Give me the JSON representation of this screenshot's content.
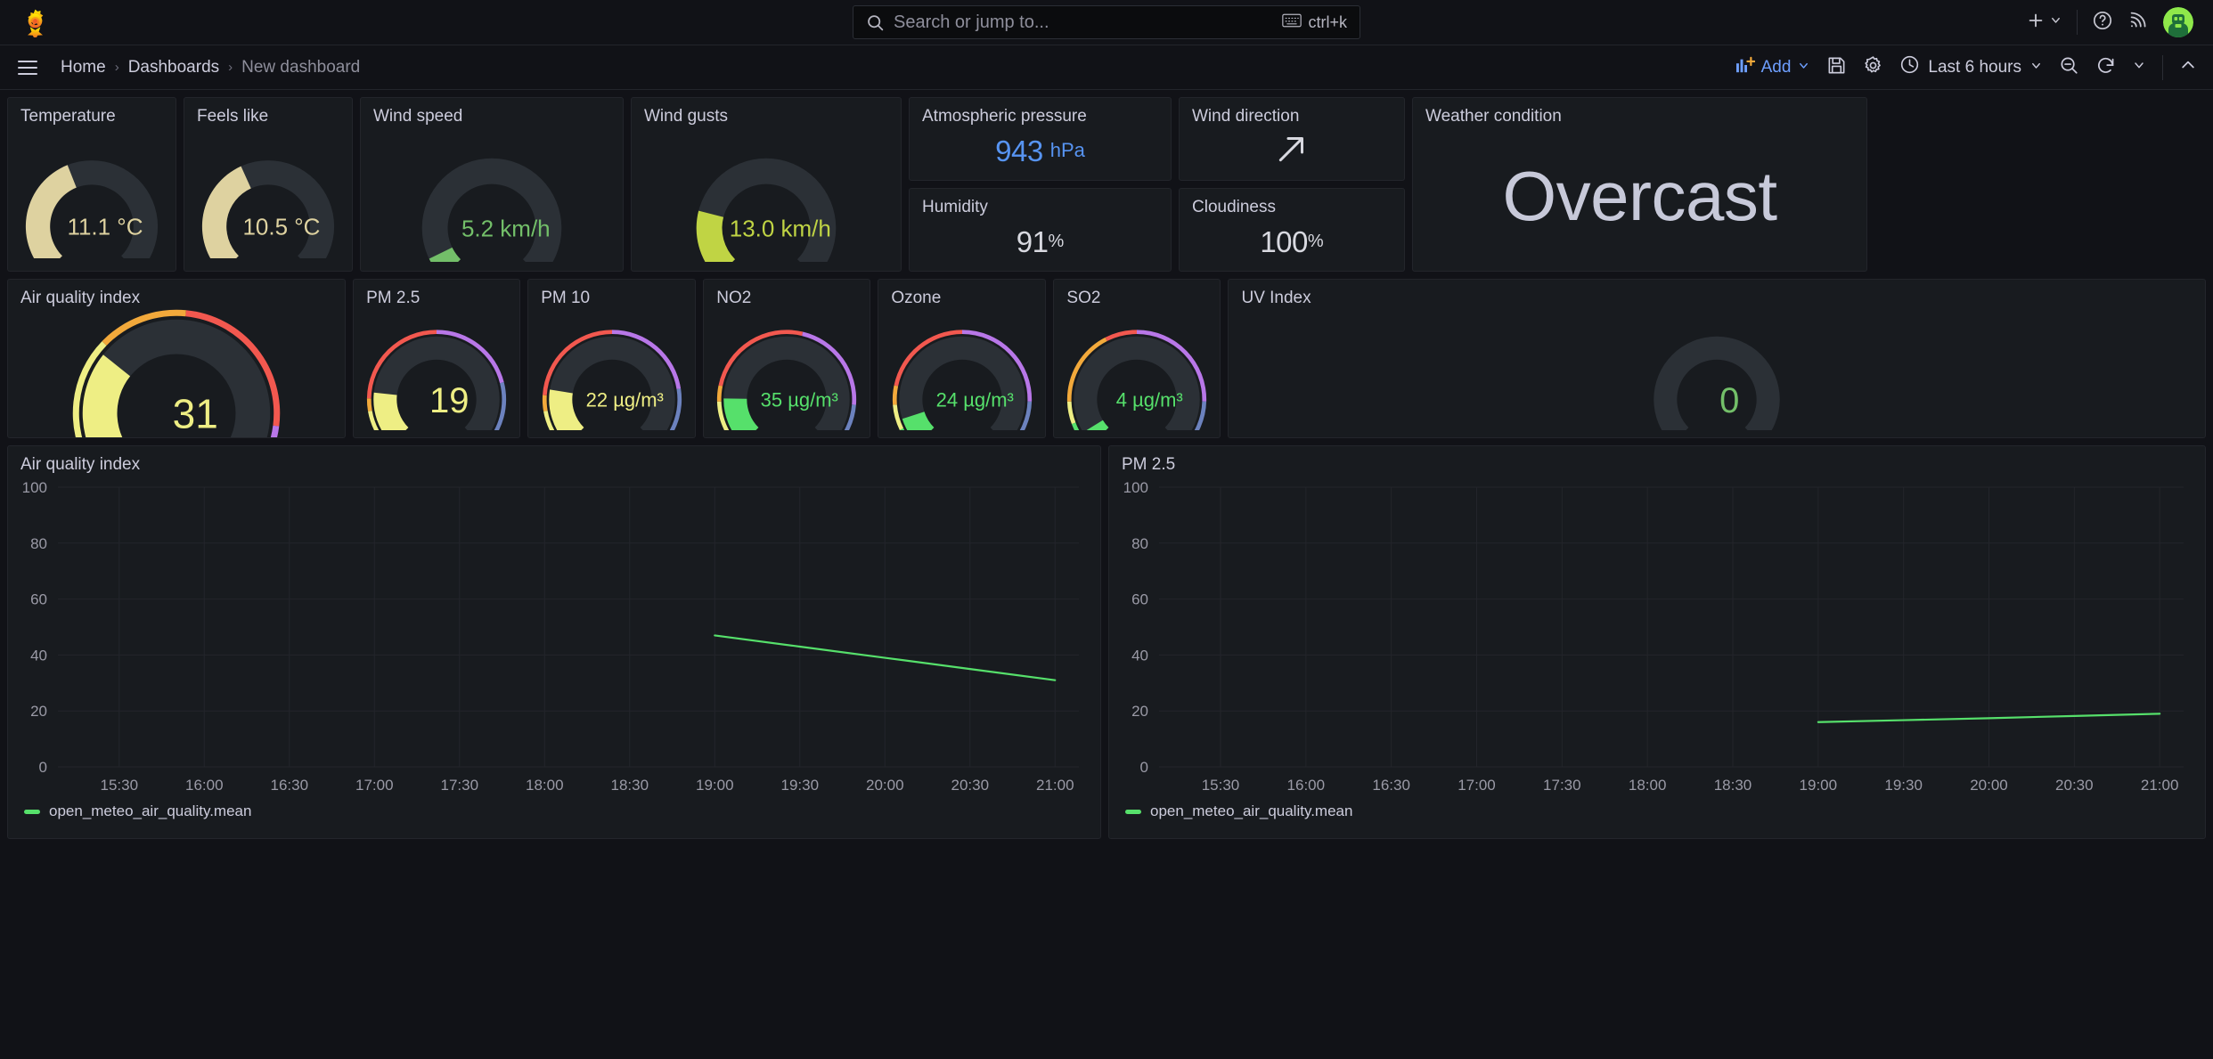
{
  "topnav": {
    "brand_icon": "grafana-logo-icon",
    "search": {
      "icon": "search-icon",
      "placeholder": "Search or jump to...",
      "value": "",
      "shortcut_icon": "keyboard-icon",
      "shortcut": "ctrl+k"
    },
    "actions": [
      {
        "name": "new-button",
        "icon": "plus-icon",
        "label": ""
      },
      {
        "name": "new-button-chevron",
        "icon": "chevron-down-icon",
        "label": ""
      },
      {
        "name": "help-button",
        "icon": "question-circle-icon",
        "label": ""
      },
      {
        "name": "news-button",
        "icon": "rss-icon",
        "label": ""
      },
      {
        "name": "profile-avatar",
        "icon": "avatar-icon",
        "label": ""
      }
    ]
  },
  "dashbar": {
    "menu_icon": "hamburger-menu-icon",
    "breadcrumbs": [
      {
        "label": "Home",
        "current": false
      },
      {
        "label": "Dashboards",
        "current": false
      },
      {
        "label": "New dashboard",
        "current": true
      }
    ],
    "add_label": "Add",
    "add_icon": "add-panel-icon",
    "add_chevron": "chevron-down-icon",
    "save_icon": "save-icon",
    "settings_icon": "gear-icon",
    "time_icon": "clock-icon",
    "time_range": "Last 6 hours",
    "time_chevron": "chevron-down-icon",
    "zoom_out_icon": "zoom-out-icon",
    "refresh_icon": "refresh-icon",
    "refresh_chevron": "chevron-down-icon",
    "collapse_icon": "chevron-up-icon"
  },
  "colors": {
    "panel_bg": "#181b1f",
    "page_bg": "#111217",
    "border": "#23252b",
    "text": "#ccccdc",
    "green": "#73BF69",
    "bright_green": "#56E06B",
    "yellow": "#EEEE84",
    "khaki": "#DED2A0",
    "yellow_green": "#C0D444",
    "orange": "#F2A93B",
    "red": "#F2584F",
    "purple": "#B877E8",
    "blue": "#5794F2",
    "slate_blue": "#6C82BE",
    "gauge_track": "#2b3036",
    "grid": "#23252b"
  },
  "panels": {
    "row1": [
      {
        "title": "Temperature",
        "type": "gauge",
        "value": "11.1",
        "unit": "°C",
        "display": "11.1 °C",
        "pct": 0.42,
        "value_color": "#DED2A0",
        "thresholds": []
      },
      {
        "title": "Feels like",
        "type": "gauge",
        "value": "10.5",
        "unit": "°C",
        "display": "10.5 °C",
        "pct": 0.41,
        "value_color": "#DED2A0",
        "thresholds": []
      },
      {
        "title": "Wind speed",
        "type": "gauge",
        "value": "5.2",
        "unit": "km/h",
        "display": "5.2 km/h",
        "pct": 0.07,
        "value_color": "#73BF69",
        "thresholds": []
      },
      {
        "title": "Wind gusts",
        "type": "gauge",
        "value": "13.0",
        "unit": "km/h",
        "display": "13.0 km/h",
        "pct": 0.22,
        "value_color": "#C0D444",
        "thresholds": []
      }
    ],
    "pressure": {
      "title": "Atmospheric pressure",
      "type": "stat",
      "value": "943",
      "unit": "hPa",
      "value_color": "#5794F2",
      "unit_color": "#5794F2"
    },
    "winddir": {
      "title": "Wind direction",
      "type": "arrow",
      "icon": "arrow-northeast-icon",
      "rotation_deg": 45,
      "arrow_color": "#ccccdc"
    },
    "humidity": {
      "title": "Humidity",
      "type": "stat",
      "value": "91",
      "unit": "%",
      "value_color": "#d8d9e0",
      "unit_color": "#d8d9e0"
    },
    "cloudiness": {
      "title": "Cloudiness",
      "type": "stat",
      "value": "100",
      "unit": "%",
      "value_color": "#d8d9e0",
      "unit_color": "#d8d9e0"
    },
    "condition": {
      "title": "Weather condition",
      "type": "text",
      "value": "Overcast",
      "value_color": "#c7c9d9"
    },
    "row2": [
      {
        "title": "Air quality index",
        "type": "gauge",
        "value": "31",
        "unit": "",
        "display": "31",
        "pct": 0.31,
        "value_color": "#EEEE84",
        "thresholds": [
          {
            "color": "#56E06B",
            "from": 0.0,
            "to": 0.05
          },
          {
            "color": "#EEEE84",
            "from": 0.05,
            "to": 0.33
          },
          {
            "color": "#F2A93B",
            "from": 0.33,
            "to": 0.52
          },
          {
            "color": "#F2584F",
            "from": 0.52,
            "to": 0.86
          },
          {
            "color": "#B877E8",
            "from": 0.86,
            "to": 1.0
          }
        ]
      },
      {
        "title": "PM 2.5",
        "type": "gauge",
        "value": "19",
        "unit": "",
        "display": "19",
        "pct": 0.19,
        "value_color": "#EEEE84",
        "thresholds": [
          {
            "color": "#56E06B",
            "from": 0.0,
            "to": 0.05
          },
          {
            "color": "#EEEE84",
            "from": 0.05,
            "to": 0.13
          },
          {
            "color": "#F2A93B",
            "from": 0.13,
            "to": 0.17
          },
          {
            "color": "#F2584F",
            "from": 0.17,
            "to": 0.5
          },
          {
            "color": "#B877E8",
            "from": 0.5,
            "to": 0.78
          },
          {
            "color": "#6C82BE",
            "from": 0.78,
            "to": 1.0
          }
        ]
      },
      {
        "title": "PM 10",
        "type": "gauge",
        "value": "22",
        "unit": "µg/m³",
        "display": "22 µg/m³",
        "pct": 0.2,
        "value_color": "#EEEE84",
        "thresholds": [
          {
            "color": "#56E06B",
            "from": 0.0,
            "to": 0.05
          },
          {
            "color": "#EEEE84",
            "from": 0.05,
            "to": 0.13
          },
          {
            "color": "#F2A93B",
            "from": 0.13,
            "to": 0.18
          },
          {
            "color": "#F2584F",
            "from": 0.18,
            "to": 0.5
          },
          {
            "color": "#B877E8",
            "from": 0.5,
            "to": 0.8
          },
          {
            "color": "#6C82BE",
            "from": 0.8,
            "to": 1.0
          }
        ]
      },
      {
        "title": "NO2",
        "type": "gauge",
        "value": "35",
        "unit": "µg/m³",
        "display": "35 µg/m³",
        "pct": 0.17,
        "value_color": "#56E06B",
        "thresholds": [
          {
            "color": "#56E06B",
            "from": 0.0,
            "to": 0.06
          },
          {
            "color": "#EEEE84",
            "from": 0.06,
            "to": 0.16
          },
          {
            "color": "#F2A93B",
            "from": 0.16,
            "to": 0.21
          },
          {
            "color": "#F2584F",
            "from": 0.21,
            "to": 0.55
          },
          {
            "color": "#B877E8",
            "from": 0.55,
            "to": 0.85
          },
          {
            "color": "#6C82BE",
            "from": 0.85,
            "to": 1.0
          }
        ]
      },
      {
        "title": "Ozone",
        "type": "gauge",
        "value": "24",
        "unit": "µg/m³",
        "display": "24 µg/m³",
        "pct": 0.1,
        "value_color": "#56E06B",
        "thresholds": [
          {
            "color": "#56E06B",
            "from": 0.0,
            "to": 0.07
          },
          {
            "color": "#EEEE84",
            "from": 0.07,
            "to": 0.15
          },
          {
            "color": "#F2A93B",
            "from": 0.15,
            "to": 0.21
          },
          {
            "color": "#F2584F",
            "from": 0.21,
            "to": 0.5
          },
          {
            "color": "#B877E8",
            "from": 0.5,
            "to": 0.84
          },
          {
            "color": "#6C82BE",
            "from": 0.84,
            "to": 1.0
          }
        ]
      },
      {
        "title": "SO2",
        "type": "gauge",
        "value": "4",
        "unit": "µg/m³",
        "display": "4 µg/m³",
        "pct": 0.05,
        "value_color": "#56E06B",
        "thresholds": [
          {
            "color": "#56E06B",
            "from": 0.0,
            "to": 0.09
          },
          {
            "color": "#EEEE84",
            "from": 0.09,
            "to": 0.16
          },
          {
            "color": "#F2A93B",
            "from": 0.16,
            "to": 0.4
          },
          {
            "color": "#F2584F",
            "from": 0.4,
            "to": 0.5
          },
          {
            "color": "#B877E8",
            "from": 0.5,
            "to": 0.84
          },
          {
            "color": "#6C82BE",
            "from": 0.84,
            "to": 1.0
          }
        ]
      },
      {
        "title": "UV Index",
        "type": "gauge",
        "value": "0",
        "unit": "",
        "display": "0",
        "pct": 0.0,
        "value_color": "#73BF69",
        "thresholds": []
      }
    ]
  },
  "chart_data": [
    {
      "type": "line",
      "title": "Air quality index",
      "xlabel": "",
      "ylabel": "",
      "ylim": [
        0,
        100
      ],
      "yticks": [
        0,
        20,
        40,
        60,
        80,
        100
      ],
      "xticks": [
        "15:30",
        "16:00",
        "16:30",
        "17:00",
        "17:30",
        "18:00",
        "18:30",
        "19:00",
        "19:30",
        "20:00",
        "20:30",
        "21:00"
      ],
      "grid": true,
      "legend": {
        "position": "bottom",
        "entries": [
          "open_meteo_air_quality.mean"
        ]
      },
      "series": [
        {
          "name": "open_meteo_air_quality.mean",
          "color": "#56E06B",
          "x": [
            "19:00",
            "19:30",
            "20:00",
            "20:30",
            "21:00"
          ],
          "values": [
            47,
            43,
            39,
            35,
            31
          ]
        }
      ]
    },
    {
      "type": "line",
      "title": "PM 2.5",
      "xlabel": "",
      "ylabel": "",
      "ylim": [
        0,
        100
      ],
      "yticks": [
        0,
        20,
        40,
        60,
        80,
        100
      ],
      "xticks": [
        "15:30",
        "16:00",
        "16:30",
        "17:00",
        "17:30",
        "18:00",
        "18:30",
        "19:00",
        "19:30",
        "20:00",
        "20:30",
        "21:00"
      ],
      "grid": true,
      "legend": {
        "position": "bottom",
        "entries": [
          "open_meteo_air_quality.mean"
        ]
      },
      "series": [
        {
          "name": "open_meteo_air_quality.mean",
          "color": "#56E06B",
          "x": [
            "19:00",
            "19:30",
            "20:00",
            "20:30",
            "21:00"
          ],
          "values": [
            16,
            16.7,
            17.4,
            18.2,
            19
          ]
        }
      ]
    }
  ]
}
